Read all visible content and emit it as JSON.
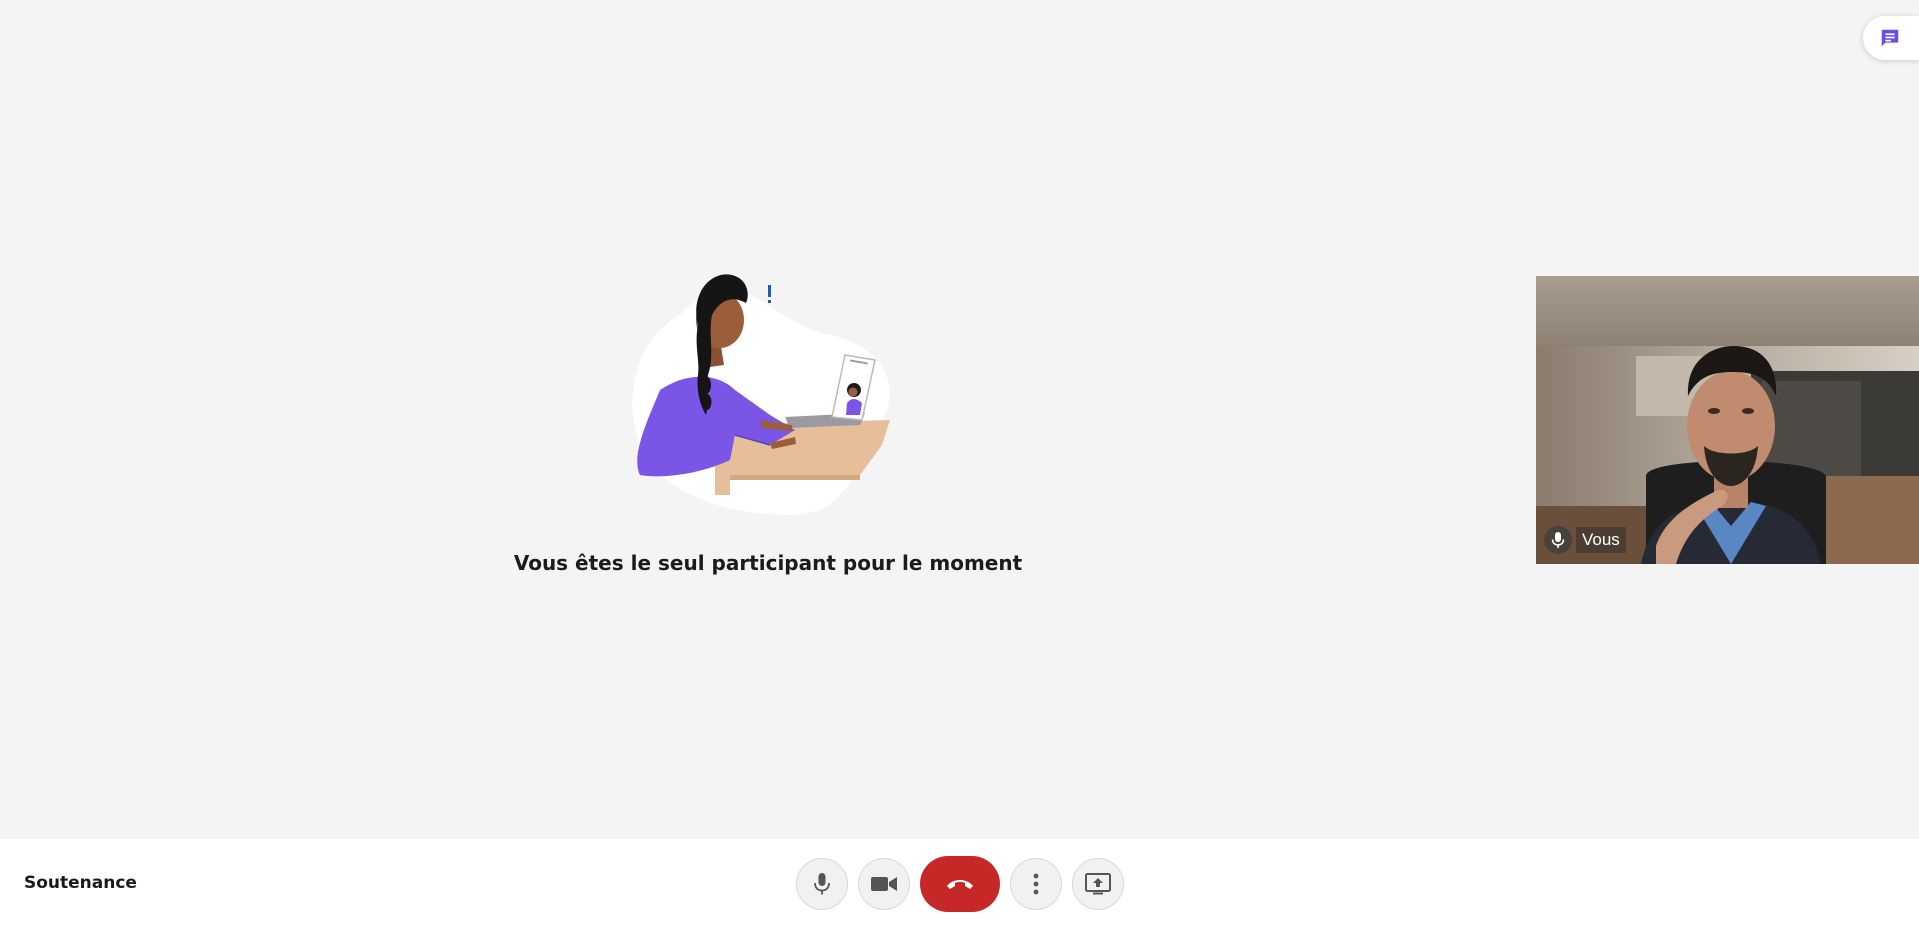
{
  "meeting": {
    "name": "Soutenance",
    "empty_message": "Vous êtes le seul participant pour le moment"
  },
  "self_view": {
    "label": "Vous"
  },
  "icons": {
    "chat": "chat-icon",
    "microphone": "microphone-icon",
    "camera": "video-camera-icon",
    "hangup": "phone-hangup-icon",
    "more": "more-vertical-icon",
    "share": "screen-share-icon"
  },
  "colors": {
    "accent": "#6b4ee6",
    "hangup": "#c62828",
    "background": "#f4f4f5",
    "toolbar": "#ffffff"
  }
}
